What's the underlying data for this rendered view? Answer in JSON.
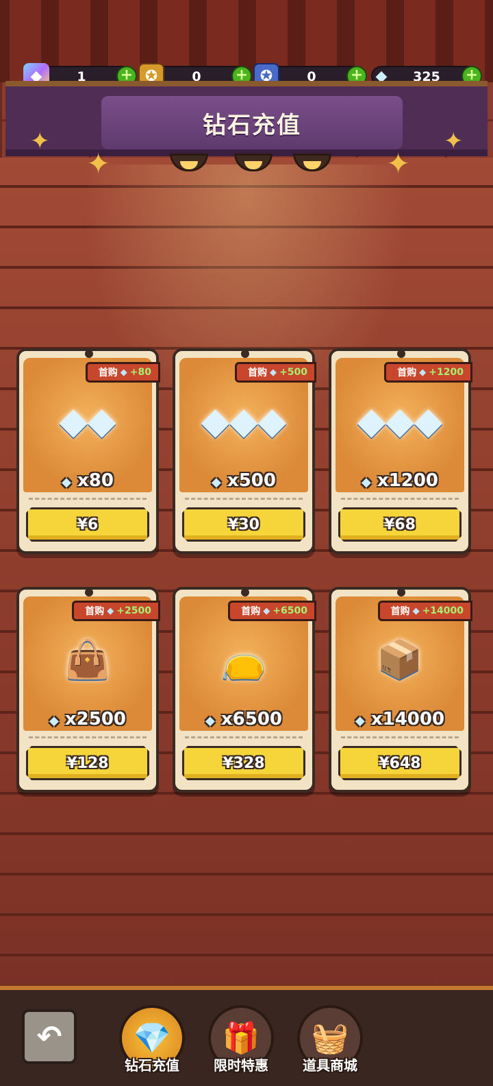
{
  "currencies": [
    {
      "icon": "crystal-cube-icon",
      "value": "1"
    },
    {
      "icon": "gold-ticket-icon",
      "value": "0"
    },
    {
      "icon": "blue-ticket-icon",
      "value": "0"
    },
    {
      "icon": "diamond-icon",
      "value": "325"
    }
  ],
  "plus_label": "+",
  "title": "钻石充值",
  "first_purchase_label": "首购",
  "packs": [
    {
      "amount": "x80",
      "bonus": "+80",
      "price": "¥6"
    },
    {
      "amount": "x500",
      "bonus": "+500",
      "price": "¥30"
    },
    {
      "amount": "x1200",
      "bonus": "+1200",
      "price": "¥68"
    },
    {
      "amount": "x2500",
      "bonus": "+2500",
      "price": "¥128"
    },
    {
      "amount": "x6500",
      "bonus": "+6500",
      "price": "¥328"
    },
    {
      "amount": "x14000",
      "bonus": "+14000",
      "price": "¥648"
    }
  ],
  "nav": {
    "back_icon": "back-arrow-icon",
    "items": [
      {
        "label": "钻石充值",
        "icon": "diamond-pile-icon",
        "active": true
      },
      {
        "label": "限时特惠",
        "icon": "gift-box-icon",
        "active": false
      },
      {
        "label": "道具商城",
        "icon": "shopping-basket-icon",
        "active": false
      }
    ]
  },
  "colors": {
    "price_button": "#f6d53a",
    "tag_bg": "#c8462b",
    "bonus_text": "#a8f070",
    "plus_button": "#4ab31e"
  }
}
